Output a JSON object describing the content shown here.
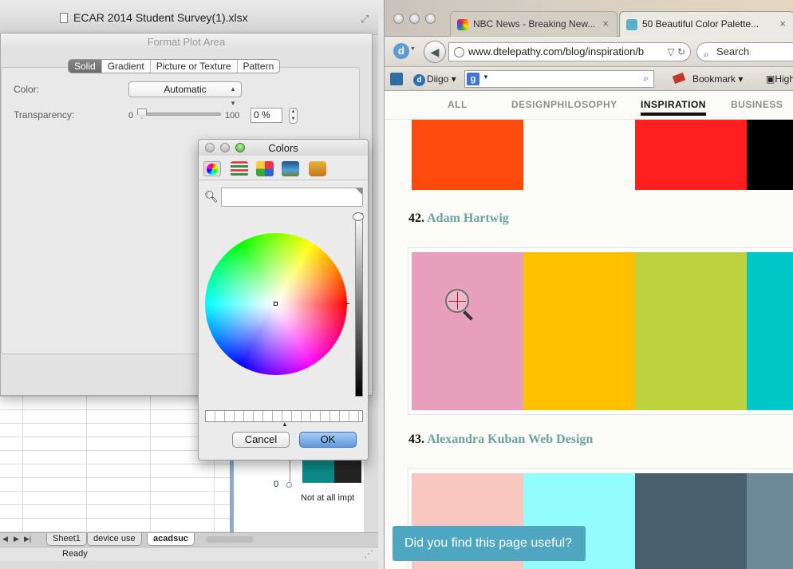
{
  "excel": {
    "title": "ECAR 2014 Student Survey(1).xlsx",
    "sheet_tabs": [
      {
        "label": "Sheet1",
        "active": false
      },
      {
        "label": "device use",
        "active": false
      },
      {
        "label": "acadsuc",
        "active": true
      }
    ],
    "status": "Ready",
    "chart": {
      "axis_zero": "0",
      "category_label": "Not at all impt",
      "colors": [
        "#0d8a8a",
        "#242424"
      ]
    }
  },
  "format_dialog": {
    "title": "Format Plot Area",
    "fill_tabs": [
      "Solid",
      "Gradient",
      "Picture or Texture",
      "Pattern"
    ],
    "selected_fill_tab": "Solid",
    "color_label": "Color:",
    "color_value": "Automatic",
    "transparency_label": "Transparency:",
    "transparency_min": "0",
    "transparency_max": "100",
    "transparency_value": "0 %",
    "transparency_fraction": 0
  },
  "colors_panel": {
    "title": "Colors",
    "mode_icons": [
      "color-wheel-icon",
      "color-sliders-icon",
      "color-palettes-icon",
      "image-palettes-icon",
      "crayons-icon"
    ],
    "search_placeholder": "",
    "brightness_fraction": 1,
    "cancel_label": "Cancel",
    "ok_label": "OK"
  },
  "browser": {
    "tabs": [
      {
        "title": "NBC News - Breaking New...",
        "active": false,
        "favicon": "nbc-peacock-icon"
      },
      {
        "title": "50 Beautiful Color Palette...",
        "active": true,
        "favicon": "dtelepathy-icon"
      }
    ],
    "url": "www.dtelepathy.com/blog/inspiration/b",
    "search_placeholder": "Search",
    "toolbar": {
      "diigo_label": "Diigo",
      "bookmark_label": "Bookmark",
      "highlight_label": "Highl"
    },
    "categories": [
      "ALL",
      "DESIGN",
      "PHILOSOPHY",
      "INSPIRATION",
      "BUSINESS"
    ],
    "active_category": "INSPIRATION",
    "palettes": [
      {
        "colors": [
          "#ff4a0d",
          "#fbfbf7",
          "#ff1f1f",
          "#000000"
        ]
      },
      {
        "number": "42.",
        "name": "Adam Hartwig",
        "colors": [
          "#e89fbb",
          "#ffc000",
          "#bcd23e",
          "#00c8c8"
        ]
      },
      {
        "number": "43.",
        "name": "Alexandra Kuban Web Design",
        "colors": [
          "#f9c7c0",
          "#93fcfc",
          "#4a5f6e",
          "#6e8a99"
        ]
      }
    ],
    "feedback_prompt": "Did you find this page useful?"
  }
}
